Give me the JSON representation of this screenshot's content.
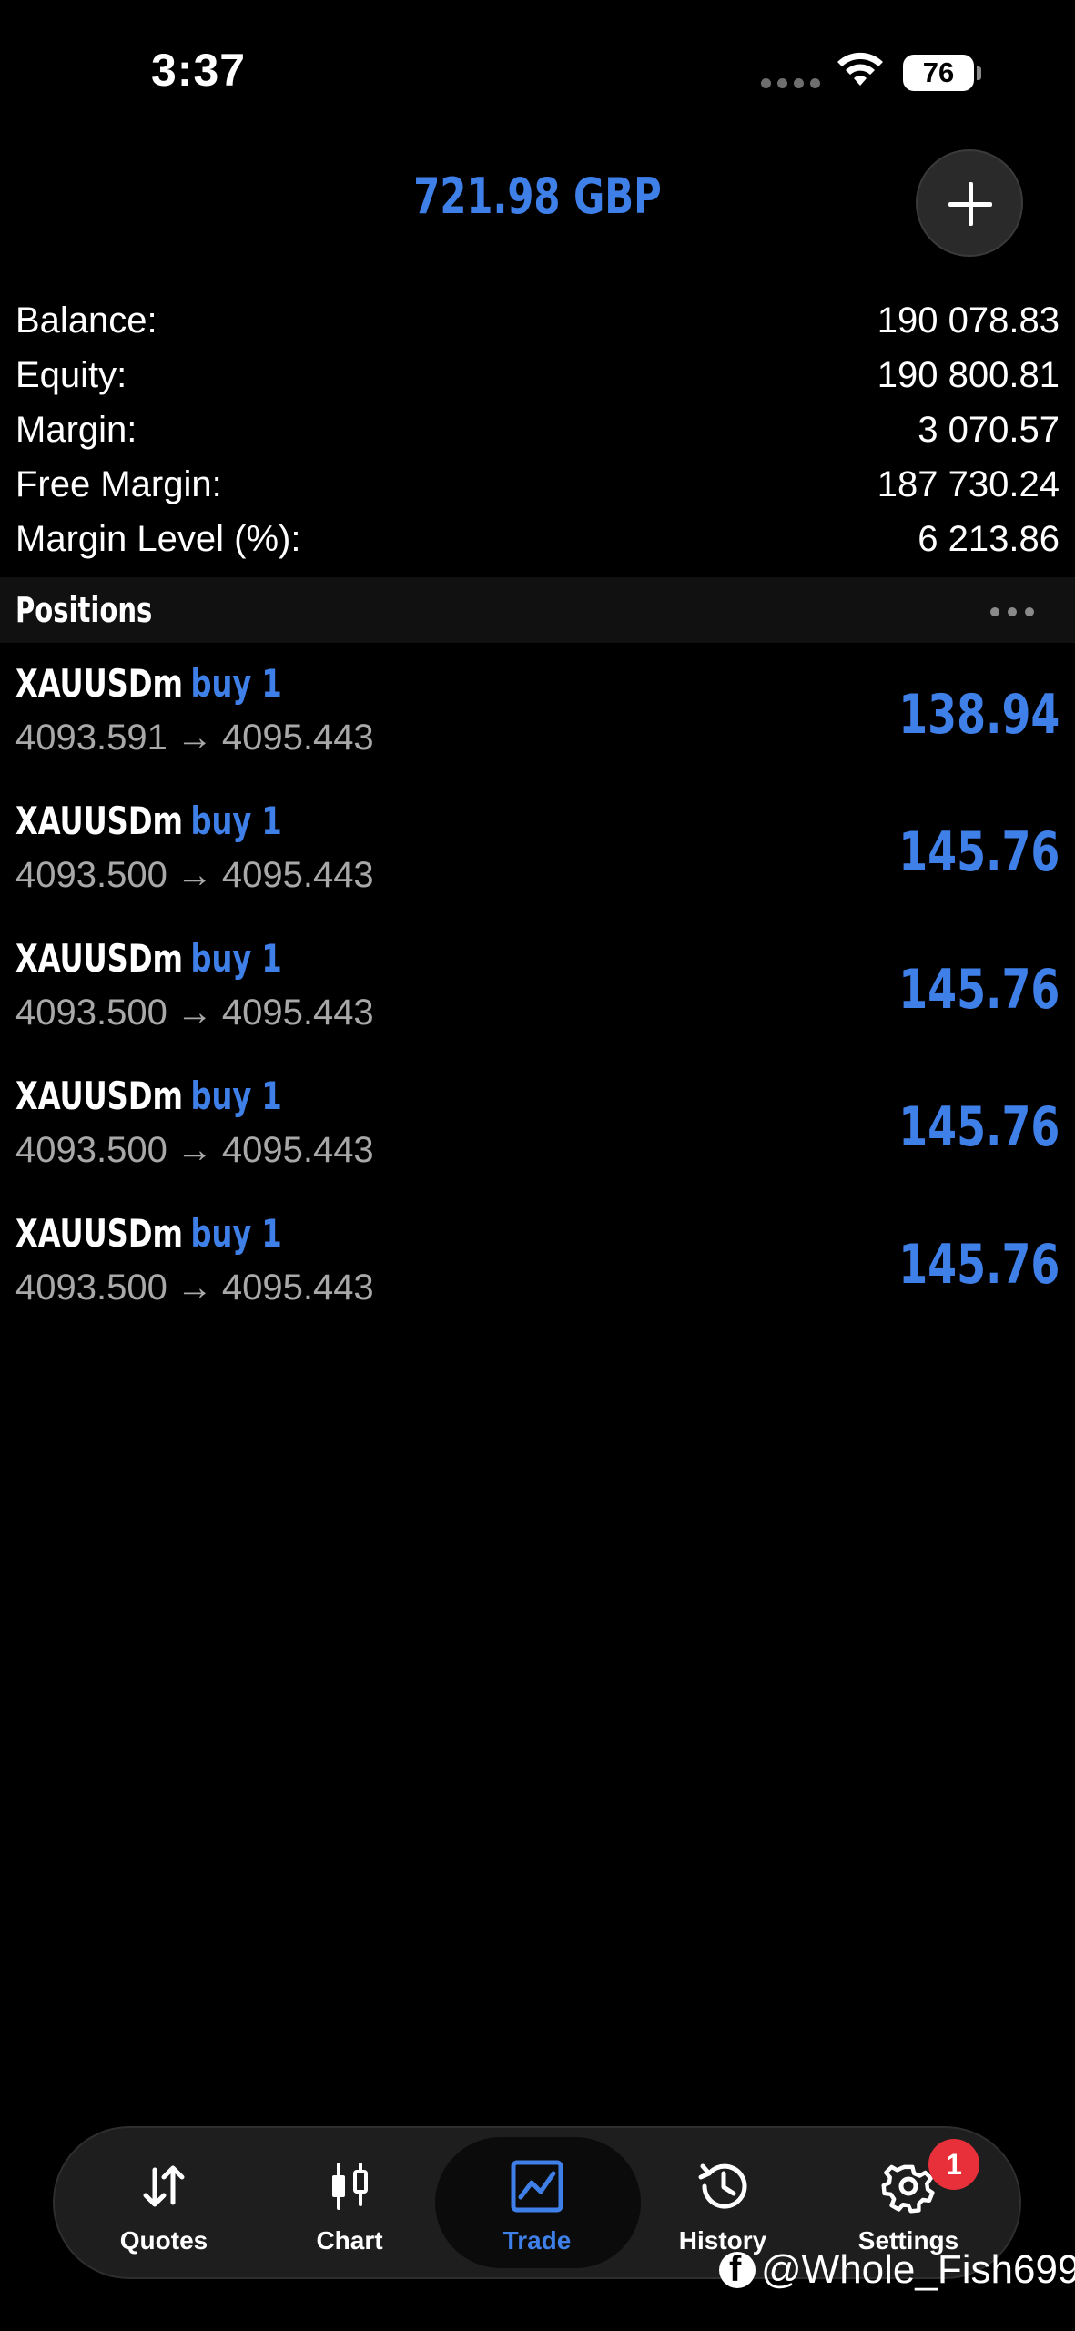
{
  "status_bar": {
    "time": "3:37",
    "battery": "76"
  },
  "header": {
    "total_profit": "721.98 GBP",
    "add_icon": "plus-icon"
  },
  "summary": [
    {
      "label": "Balance:",
      "value": "190 078.83"
    },
    {
      "label": "Equity:",
      "value": "190 800.81"
    },
    {
      "label": "Margin:",
      "value": "3 070.57"
    },
    {
      "label": "Free Margin:",
      "value": "187 730.24"
    },
    {
      "label": "Margin Level (%):",
      "value": "6 213.86"
    }
  ],
  "positions": {
    "title": "Positions",
    "items": [
      {
        "symbol": "XAUUSDm",
        "type": "buy 1",
        "open": "4093.591",
        "arrow": "→",
        "current": "4095.443",
        "profit": "138.94"
      },
      {
        "symbol": "XAUUSDm",
        "type": "buy 1",
        "open": "4093.500",
        "arrow": "→",
        "current": "4095.443",
        "profit": "145.76"
      },
      {
        "symbol": "XAUUSDm",
        "type": "buy 1",
        "open": "4093.500",
        "arrow": "→",
        "current": "4095.443",
        "profit": "145.76"
      },
      {
        "symbol": "XAUUSDm",
        "type": "buy 1",
        "open": "4093.500",
        "arrow": "→",
        "current": "4095.443",
        "profit": "145.76"
      },
      {
        "symbol": "XAUUSDm",
        "type": "buy 1",
        "open": "4093.500",
        "arrow": "→",
        "current": "4095.443",
        "profit": "145.76"
      }
    ]
  },
  "tab_bar": {
    "tabs": [
      {
        "label": "Quotes",
        "icon": "arrows-up-down-icon"
      },
      {
        "label": "Chart",
        "icon": "candlestick-icon"
      },
      {
        "label": "Trade",
        "icon": "trade-chart-icon",
        "active": true
      },
      {
        "label": "History",
        "icon": "history-clock-icon"
      },
      {
        "label": "Settings",
        "icon": "gear-icon"
      }
    ],
    "settings_badge": "1"
  },
  "watermark": "@Whole_Fish699",
  "colors": {
    "accent": "#3f7fe8",
    "background": "#000000",
    "badge": "#e8303a"
  }
}
